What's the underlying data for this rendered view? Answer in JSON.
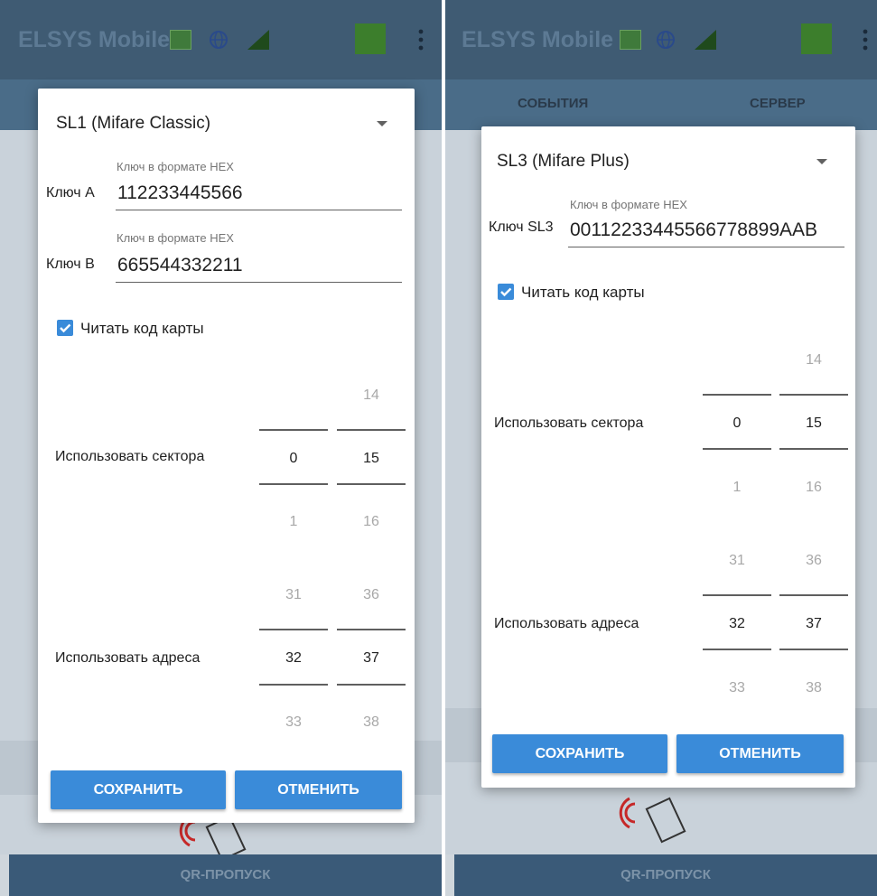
{
  "app": {
    "title": "ELSYS Mobile",
    "bottom_button": "QR-ПРОПУСК"
  },
  "icons": {
    "card": "card-reader-icon",
    "globe": "globe-icon",
    "signal": "signal-icon",
    "exit": "emergency-exit-icon",
    "more": "more-vert-icon",
    "nfc": "nfc-card-icon"
  },
  "colors": {
    "accent": "#3a8bd9",
    "appbar": "#3f5b73",
    "status_green": "#3c7e2c"
  },
  "tabs": [
    "СОБЫТИЯ",
    "СЕРВЕР"
  ],
  "left_dialog": {
    "card_type": "SL1 (Mifare Classic)",
    "key_a": {
      "label": "Ключ А",
      "hint": "Ключ в формате HEX",
      "value": "112233445566"
    },
    "key_b": {
      "label": "Ключ В",
      "hint": "Ключ в формате HEX",
      "value": "665544332211"
    },
    "read_code": {
      "label": "Читать код карты",
      "checked": true
    },
    "sectors": {
      "label": "Использовать сектора",
      "from": {
        "prev": "",
        "value": "0",
        "next": "1"
      },
      "to": {
        "prev": "14",
        "value": "15",
        "next": "16"
      }
    },
    "addresses": {
      "label": "Использовать адреса",
      "from": {
        "prev": "31",
        "value": "32",
        "next": "33"
      },
      "to": {
        "prev": "36",
        "value": "37",
        "next": "38"
      }
    },
    "save": "СОХРАНИТЬ",
    "cancel": "ОТМЕНИТЬ"
  },
  "right_dialog": {
    "card_type": "SL3 (Mifare Plus)",
    "key": {
      "label": "Ключ SL3",
      "hint": "Ключ в формате HEX",
      "value": "00112233445566778899AAB"
    },
    "read_code": {
      "label": "Читать код карты",
      "checked": true
    },
    "sectors": {
      "label": "Использовать сектора",
      "from": {
        "prev": "",
        "value": "0",
        "next": "1"
      },
      "to": {
        "prev": "14",
        "value": "15",
        "next": "16"
      }
    },
    "addresses": {
      "label": "Использовать адреса",
      "from": {
        "prev": "31",
        "value": "32",
        "next": "33"
      },
      "to": {
        "prev": "36",
        "value": "37",
        "next": "38"
      }
    },
    "save": "СОХРАНИТЬ",
    "cancel": "ОТМЕНИТЬ"
  }
}
